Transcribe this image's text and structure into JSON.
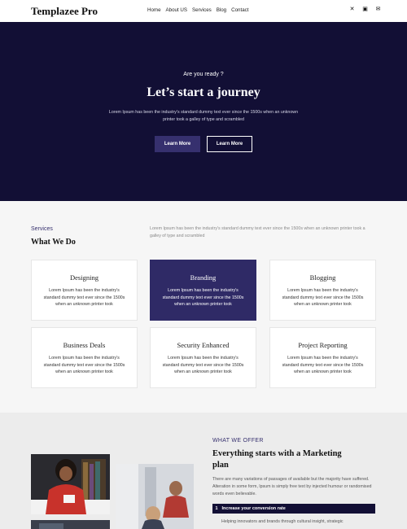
{
  "header": {
    "logo": "Templazee Pro",
    "nav": [
      "Home",
      "About US",
      "Services",
      "Blog",
      "Contact"
    ],
    "social_icons": [
      "x-icon",
      "linkedin-icon",
      "email-icon"
    ]
  },
  "hero": {
    "kicker": "Are you ready ?",
    "title": "Let’s start a journey",
    "description": "Lorem Ipsum has been the industry's standard dummy text ever since the 1500s when an unknown printer took a galley of type and scrambled",
    "primary_button": "Learn More",
    "secondary_button": "Learn More"
  },
  "services": {
    "kicker": "Services",
    "heading": "What We Do",
    "description": "Lorem Ipsum has been the industry's standard dummy text ever since the 1500s when an unknown printer took a galley of type and scrambled",
    "cards": [
      {
        "title": "Designing",
        "text": "Lorem Ipsum has been the industry's standard dummy text ever since the 1500s when an unknown printer took"
      },
      {
        "title": "Branding",
        "text": "Lorem Ipsum has been the industry's standard dummy text ever since the 1500s when an unknown printer took"
      },
      {
        "title": "Blogging",
        "text": "Lorem Ipsum has been the industry's standard dummy text ever since the 1500s when an unknown printer took"
      },
      {
        "title": "Business Deals",
        "text": "Lorem Ipsum has been the industry's standard dummy text ever since the 1500s when an unknown printer took"
      },
      {
        "title": "Security Enhanced",
        "text": "Lorem Ipsum has been the industry's standard dummy text ever since the 1500s when an unknown printer took"
      },
      {
        "title": "Project Reporting",
        "text": "Lorem Ipsum has been the industry's standard dummy text ever since the 1500s when an unknown printer took"
      }
    ]
  },
  "offer": {
    "kicker": "WHAT WE OFFER",
    "title": "Everything starts with a Marketing plan",
    "description": "There are many variations of passages of available but the majority have suffered. Alteration in some form, lpsum is simply free text by injected humour or randomised words even believable.",
    "accordion_number": "1",
    "accordion_label": "Increase your conversion rate",
    "accordion_text": "Helping innovators and brands through cultural insight, strategic"
  },
  "colors": {
    "navy": "#120f35",
    "accent": "#2f2a66"
  }
}
